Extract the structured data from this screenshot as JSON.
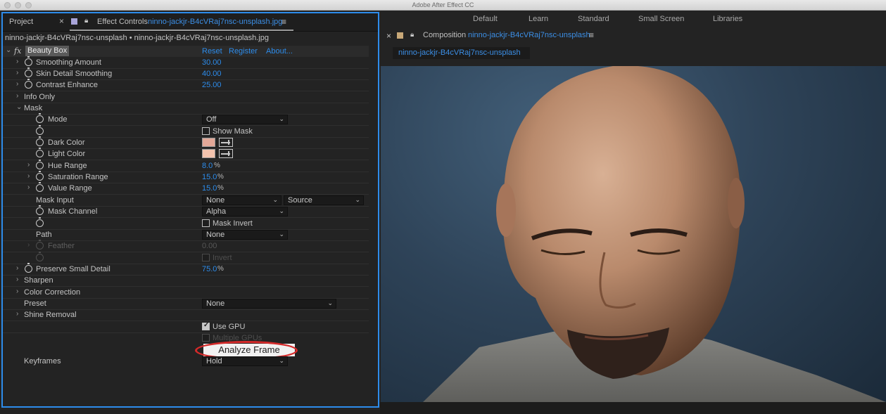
{
  "app_title": "Adobe After Effect CC",
  "workspaces": [
    "Default",
    "Learn",
    "Standard",
    "Small Screen",
    "Libraries"
  ],
  "left_panel": {
    "tab_project": "Project",
    "tab_effect_controls": "Effect Controls",
    "tab_file": "ninno-jackjr-B4cVRaj7nsc-unsplash.jpg",
    "comp_path": "ninno-jackjr-B4cVRaj7nsc-unsplash • ninno-jackjr-B4cVRaj7nsc-unsplash.jpg",
    "effect": {
      "name": "Beauty Box",
      "fx_glyph": "fx",
      "reset": "Reset",
      "register": "Register",
      "about": "About...",
      "smoothing_amount": {
        "label": "Smoothing Amount",
        "value": "30.00"
      },
      "skin_detail_smoothing": {
        "label": "Skin Detail Smoothing",
        "value": "40.00"
      },
      "contrast_enhance": {
        "label": "Contrast Enhance",
        "value": "25.00"
      },
      "info_only": "Info Only",
      "mask": {
        "label": "Mask",
        "mode_label": "Mode",
        "mode_value": "Off",
        "show_mask": "Show Mask",
        "dark_color_label": "Dark Color",
        "dark_color": "#e3a898",
        "light_color_label": "Light Color",
        "light_color": "#f3c3ae",
        "hue_range_label": "Hue Range",
        "hue_range_value": "8.0",
        "saturation_range_label": "Saturation Range",
        "saturation_range_value": "15.0",
        "value_range_label": "Value Range",
        "value_range_value": "15.0",
        "percent": "%",
        "mask_input_label": "Mask Input",
        "mask_input_value": "None",
        "mask_input_source": "Source",
        "mask_channel_label": "Mask Channel",
        "mask_channel_value": "Alpha",
        "mask_invert": "Mask Invert",
        "path_label": "Path",
        "path_value": "None",
        "feather_label": "Feather",
        "feather_value": "0.00",
        "invert": "Invert"
      },
      "preserve_small_detail": {
        "label": "Preserve Small Detail",
        "value": "75.0"
      },
      "sharpen": "Sharpen",
      "color_correction": "Color Correction",
      "preset_label": "Preset",
      "preset_value": "None",
      "shine_removal": "Shine Removal",
      "use_gpu": "Use GPU",
      "multiple_gpus": "Multiple GPUs",
      "analyze_frame": "Analyze Frame",
      "keyframes_label": "Keyframes",
      "keyframes_value": "Hold"
    }
  },
  "composition": {
    "label": "Composition",
    "name": "ninno-jackjr-B4cVRaj7nsc-unsplash",
    "subtab": "ninno-jackjr-B4cVRaj7nsc-unsplash"
  },
  "colors": {
    "accent": "#2d8ceb",
    "annotation": "#d42a2a"
  }
}
